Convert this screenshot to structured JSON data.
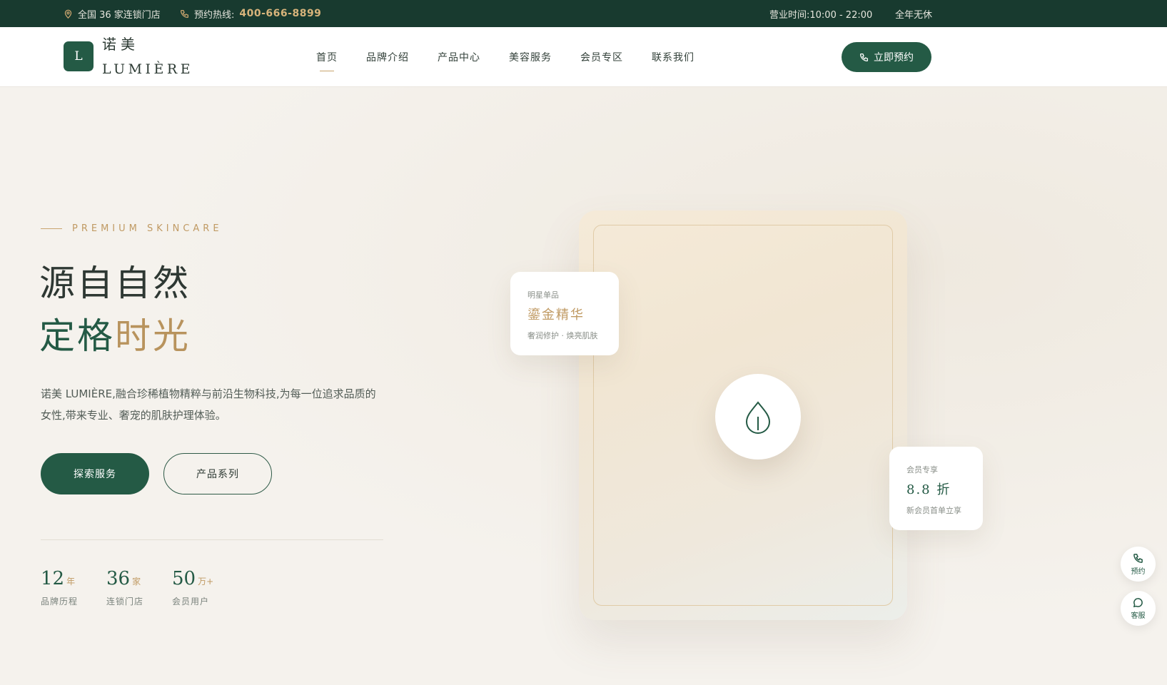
{
  "topbar": {
    "stores": "全国 36 家连锁门店",
    "hotline_label": "预约热线:",
    "hotline_number": "400-666-8899",
    "hours": "营业时间:10:00 - 22:00",
    "open_all_year": "全年无休"
  },
  "brand": {
    "logo_letter": "L",
    "name_cn": "诺美",
    "name_en": "LUMIÈRE"
  },
  "nav": {
    "items": [
      {
        "label": "首页",
        "active": true
      },
      {
        "label": "品牌介绍",
        "active": false
      },
      {
        "label": "产品中心",
        "active": false
      },
      {
        "label": "美容服务",
        "active": false
      },
      {
        "label": "会员专区",
        "active": false
      },
      {
        "label": "联系我们",
        "active": false
      }
    ],
    "cta": "立即预约"
  },
  "hero": {
    "eyebrow": "PREMIUM SKINCARE",
    "headline_line1": "源自自然",
    "headline_line2_a": "定格",
    "headline_line2_b": "时光",
    "intro": "诺美 LUMIÈRE,融合珍稀植物精粹与前沿生物科技,为每一位追求品质的女性,带来专业、奢宠的肌肤护理体验。",
    "btn_primary": "探索服务",
    "btn_secondary": "产品系列",
    "stats": [
      {
        "num": "12",
        "unit": "年",
        "label": "品牌历程"
      },
      {
        "num": "36",
        "unit": "家",
        "label": "连锁门店"
      },
      {
        "num": "50",
        "unit": "万+",
        "label": "会员用户"
      }
    ]
  },
  "float_cards": {
    "star": {
      "tag": "明星单品",
      "title": "鎏金精华",
      "desc": "奢润修护 · 焕亮肌肤"
    },
    "member": {
      "tag": "会员专享",
      "title": "8.8 折",
      "desc": "新会员首单立享"
    }
  },
  "side": {
    "book": "预约",
    "service": "客服"
  },
  "colors": {
    "brand_green": "#245a45",
    "topbar_green": "#183a2f",
    "gold": "#c09a63",
    "background": "#f5f2ed"
  }
}
